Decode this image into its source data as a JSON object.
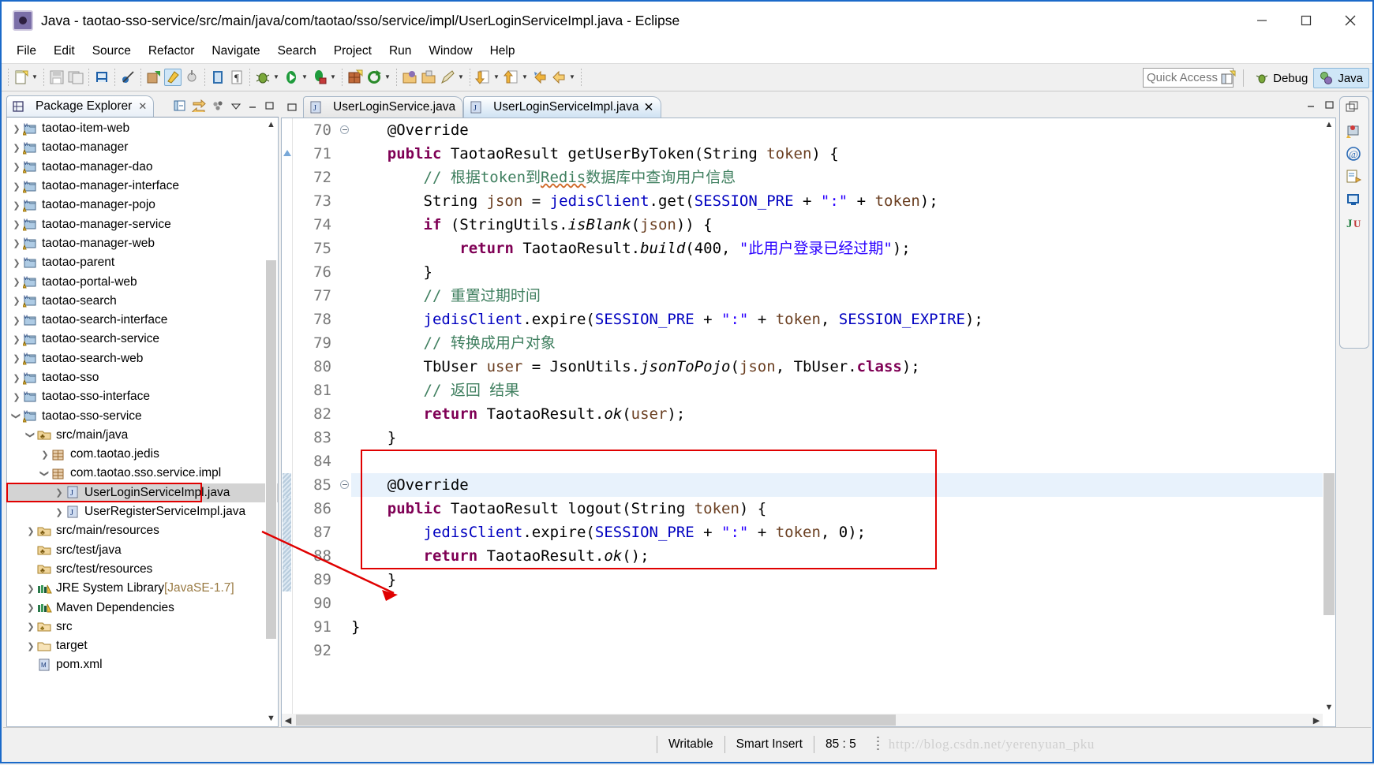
{
  "window": {
    "title": "Java - taotao-sso-service/src/main/java/com/taotao/sso/service/impl/UserLoginServiceImpl.java - Eclipse",
    "minimize_label": "─",
    "maximize_label": "☐",
    "close_label": "✕"
  },
  "menubar": {
    "items": [
      "File",
      "Edit",
      "Source",
      "Refactor",
      "Navigate",
      "Search",
      "Project",
      "Run",
      "Window",
      "Help"
    ]
  },
  "toolbar": {
    "quick_access_placeholder": "Quick Access",
    "quick_access_value": "",
    "icons": [
      "new-wizard-icon",
      "save-icon",
      "save-all-icon",
      "print-icon",
      "toggle-breakpoint-icon",
      "new-java-package-icon",
      "external-tools-icon",
      "build-icon",
      "open-type-icon",
      "format-icon",
      "debug-icon",
      "run-icon",
      "coverage-icon",
      "new-java-project-icon",
      "refresh-icon",
      "open-resource-icon",
      "open-task-icon",
      "pencil-icon",
      "next-annotation-icon",
      "previous-annotation-icon",
      "back-icon",
      "forward-icon",
      "new-editor-icon"
    ],
    "perspective": {
      "debug_label": "Debug",
      "java_label": "Java",
      "active": "Java"
    }
  },
  "package_explorer": {
    "tab_label": "Package Explorer",
    "tab_close": "✕",
    "tools": [
      "collapse-all-icon",
      "link-with-editor-icon",
      "view-menu-icon",
      "minimize-icon",
      "maximize-icon"
    ],
    "tree": [
      {
        "label": "taotao-item-web",
        "indent": 0,
        "twisty": "closed",
        "icon": "maven-project-warning-icon"
      },
      {
        "label": "taotao-manager",
        "indent": 0,
        "twisty": "closed",
        "icon": "maven-project-warning-icon"
      },
      {
        "label": "taotao-manager-dao",
        "indent": 0,
        "twisty": "closed",
        "icon": "maven-project-warning-icon"
      },
      {
        "label": "taotao-manager-interface",
        "indent": 0,
        "twisty": "closed",
        "icon": "maven-project-warning-icon"
      },
      {
        "label": "taotao-manager-pojo",
        "indent": 0,
        "twisty": "closed",
        "icon": "maven-project-warning-icon"
      },
      {
        "label": "taotao-manager-service",
        "indent": 0,
        "twisty": "closed",
        "icon": "maven-project-warning-icon"
      },
      {
        "label": "taotao-manager-web",
        "indent": 0,
        "twisty": "closed",
        "icon": "maven-project-warning-icon"
      },
      {
        "label": "taotao-parent",
        "indent": 0,
        "twisty": "closed",
        "icon": "maven-project-icon"
      },
      {
        "label": "taotao-portal-web",
        "indent": 0,
        "twisty": "closed",
        "icon": "maven-project-warning-icon"
      },
      {
        "label": "taotao-search",
        "indent": 0,
        "twisty": "closed",
        "icon": "maven-project-warning-icon"
      },
      {
        "label": "taotao-search-interface",
        "indent": 0,
        "twisty": "closed",
        "icon": "maven-project-icon"
      },
      {
        "label": "taotao-search-service",
        "indent": 0,
        "twisty": "closed",
        "icon": "maven-project-warning-icon"
      },
      {
        "label": "taotao-search-web",
        "indent": 0,
        "twisty": "closed",
        "icon": "maven-project-warning-icon"
      },
      {
        "label": "taotao-sso",
        "indent": 0,
        "twisty": "closed",
        "icon": "maven-project-warning-icon"
      },
      {
        "label": "taotao-sso-interface",
        "indent": 0,
        "twisty": "closed",
        "icon": "maven-project-icon"
      },
      {
        "label": "taotao-sso-service",
        "indent": 0,
        "twisty": "open",
        "icon": "maven-project-warning-icon"
      },
      {
        "label": "src/main/java",
        "indent": 1,
        "twisty": "open",
        "icon": "source-folder-icon"
      },
      {
        "label": "com.taotao.jedis",
        "indent": 2,
        "twisty": "closed",
        "icon": "package-icon"
      },
      {
        "label": "com.taotao.sso.service.impl",
        "indent": 2,
        "twisty": "open",
        "icon": "package-icon"
      },
      {
        "label": "UserLoginServiceImpl.java",
        "indent": 3,
        "twisty": "closed",
        "icon": "java-file-icon",
        "selected": true
      },
      {
        "label": "UserRegisterServiceImpl.java",
        "indent": 3,
        "twisty": "closed",
        "icon": "java-file-icon"
      },
      {
        "label": "src/main/resources",
        "indent": 1,
        "twisty": "closed",
        "icon": "source-folder-icon"
      },
      {
        "label": "src/test/java",
        "indent": 1,
        "twisty": "none",
        "icon": "source-folder-icon"
      },
      {
        "label": "src/test/resources",
        "indent": 1,
        "twisty": "none",
        "icon": "source-folder-icon"
      },
      {
        "label": "JRE System Library",
        "suffix": " [JavaSE-1.7]",
        "indent": 1,
        "twisty": "closed",
        "icon": "library-icon"
      },
      {
        "label": "Maven Dependencies",
        "indent": 1,
        "twisty": "closed",
        "icon": "library-icon"
      },
      {
        "label": "src",
        "indent": 1,
        "twisty": "closed",
        "icon": "folder-icon"
      },
      {
        "label": "target",
        "indent": 1,
        "twisty": "closed",
        "icon": "folder-plain-icon"
      },
      {
        "label": "pom.xml",
        "indent": 1,
        "twisty": "none",
        "icon": "pom-xml-icon"
      }
    ]
  },
  "editor": {
    "tabs": [
      {
        "label": "UserLoginService.java",
        "active": false,
        "icon": "java-file-icon",
        "close": ""
      },
      {
        "label": "UserLoginServiceImpl.java",
        "active": true,
        "icon": "java-file-icon",
        "close": "✕"
      }
    ],
    "first_line": 70,
    "lines": [
      {
        "n": 70,
        "fold": true,
        "marker": "",
        "text": "    @Override"
      },
      {
        "n": 71,
        "fold": false,
        "marker": "warn",
        "text": "    public TaotaoResult getUserByToken(String token) {"
      },
      {
        "n": 72,
        "fold": false,
        "marker": "",
        "text": "        // 根据token到Redis数据库中查询用户信息"
      },
      {
        "n": 73,
        "fold": false,
        "marker": "",
        "text": "        String json = jedisClient.get(SESSION_PRE + \":\" + token);"
      },
      {
        "n": 74,
        "fold": false,
        "marker": "",
        "text": "        if (StringUtils.isBlank(json)) {"
      },
      {
        "n": 75,
        "fold": false,
        "marker": "",
        "text": "            return TaotaoResult.build(400, \"此用户登录已经过期\");"
      },
      {
        "n": 76,
        "fold": false,
        "marker": "",
        "text": "        }"
      },
      {
        "n": 77,
        "fold": false,
        "marker": "",
        "text": "        // 重置过期时间"
      },
      {
        "n": 78,
        "fold": false,
        "marker": "",
        "text": "        jedisClient.expire(SESSION_PRE + \":\" + token, SESSION_EXPIRE);"
      },
      {
        "n": 79,
        "fold": false,
        "marker": "",
        "text": "        // 转换成用户对象"
      },
      {
        "n": 80,
        "fold": false,
        "marker": "",
        "text": "        TbUser user = JsonUtils.jsonToPojo(json, TbUser.class);"
      },
      {
        "n": 81,
        "fold": false,
        "marker": "",
        "text": "        // 返回 结果"
      },
      {
        "n": 82,
        "fold": false,
        "marker": "",
        "text": "        return TaotaoResult.ok(user);"
      },
      {
        "n": 83,
        "fold": false,
        "marker": "",
        "text": "    }"
      },
      {
        "n": 84,
        "fold": false,
        "marker": "",
        "text": ""
      },
      {
        "n": 85,
        "fold": true,
        "marker": "chg",
        "text": "    @Override",
        "current": true
      },
      {
        "n": 86,
        "fold": false,
        "marker": "chgw",
        "text": "    public TaotaoResult logout(String token) {"
      },
      {
        "n": 87,
        "fold": false,
        "marker": "chg",
        "text": "        jedisClient.expire(SESSION_PRE + \":\" + token, 0);"
      },
      {
        "n": 88,
        "fold": false,
        "marker": "chg",
        "text": "        return TaotaoResult.ok();"
      },
      {
        "n": 89,
        "fold": false,
        "marker": "chg",
        "text": "    }"
      },
      {
        "n": 90,
        "fold": false,
        "marker": "",
        "text": ""
      },
      {
        "n": 91,
        "fold": false,
        "marker": "",
        "text": "}"
      },
      {
        "n": 92,
        "fold": false,
        "marker": "",
        "text": ""
      }
    ]
  },
  "fastview": {
    "icons": [
      "restore-icon",
      "debug-view-icon",
      "at-sign-icon",
      "outline-view-icon",
      "console-view-icon",
      "junit-view-icon"
    ]
  },
  "statusbar": {
    "writable": "Writable",
    "insert_mode": "Smart Insert",
    "position": "85 : 5",
    "watermark": "http://blog.csdn.net/yerenyuan_pku"
  },
  "colors": {
    "keyword": "#7f0055",
    "comment": "#3f7f5f",
    "string": "#2a00ff",
    "field": "#0000c0",
    "local": "#6a3e20",
    "annotation_box": "#e00000",
    "current_line": "#e8f2fc",
    "selection": "#d3d3d3",
    "accent": "#1b6ac9"
  }
}
